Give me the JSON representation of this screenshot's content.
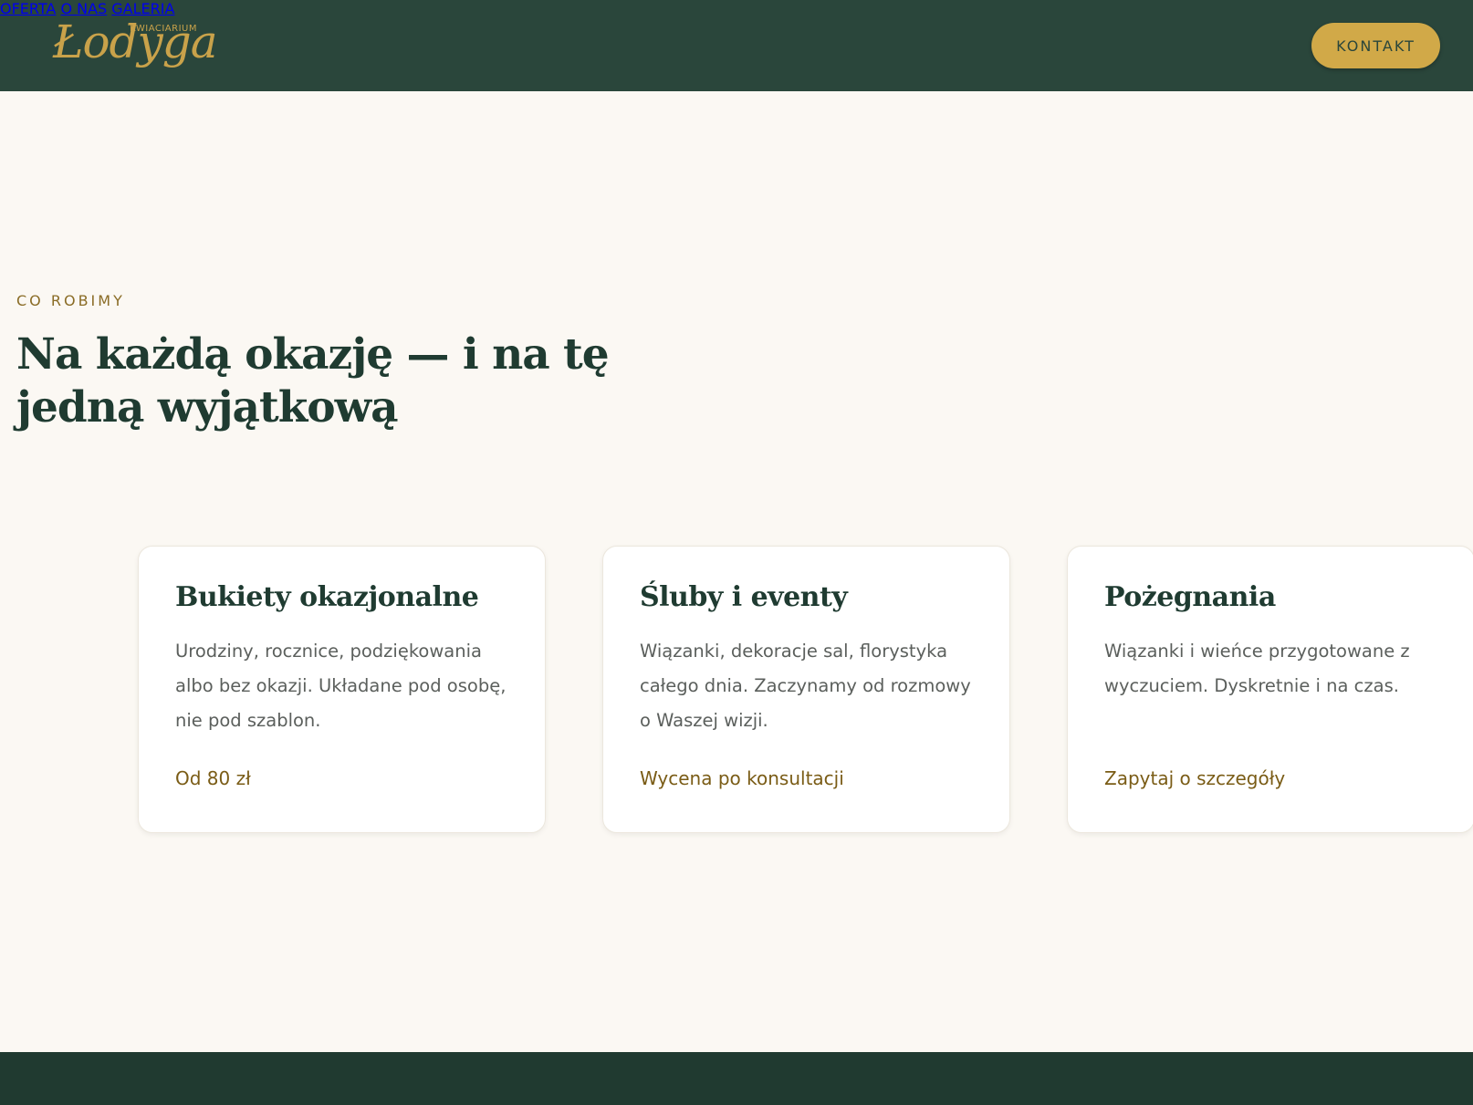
{
  "colors": {
    "header_bg": "#2a463b",
    "page_bg": "#fbf8f3",
    "accent_gold": "#d1a948",
    "heading_green": "#1f3b31",
    "price_brown": "#7a5c16",
    "footer_bg": "#203a30"
  },
  "header": {
    "logo": {
      "small_text": "KWIACIARIUM",
      "script_text": "Łodyga"
    },
    "nav": [
      "OFERTA",
      "O NAS",
      "GALERIA"
    ],
    "cta_label": "KONTAKT"
  },
  "section": {
    "eyebrow": "CO ROBIMY",
    "title": "Na każdą okazję — i na tę jedną wyjątkową"
  },
  "cards": [
    {
      "title": "Bukiety okazjonalne",
      "description": "Urodziny, rocznice, podziękowania albo bez okazji. Układane pod osobę, nie pod szablon.",
      "price": "Od 80 zł"
    },
    {
      "title": "Śluby i eventy",
      "description": "Wiązanki, dekoracje sal, florystyka całego dnia. Zaczynamy od rozmowy o Waszej wizji.",
      "price": "Wycena po konsultacji"
    },
    {
      "title": "Pożegnania",
      "description": "Wiązanki i wieńce przygotowane z wyczuciem. Dyskretnie i na czas.",
      "price": "Zapytaj o szczegóły"
    }
  ]
}
